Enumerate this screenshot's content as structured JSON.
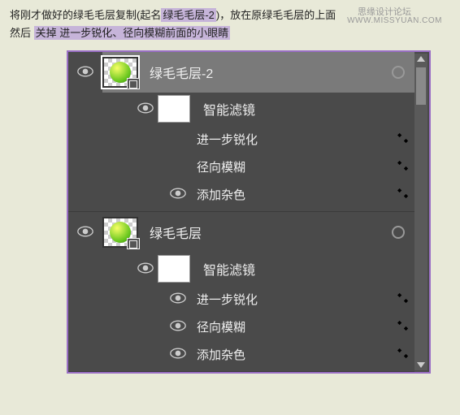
{
  "instructions": {
    "line1_a": "将刚才做好的绿毛毛层复制(起名",
    "line1_hl": "绿毛毛层-2",
    "line1_b": ")，放在原绿毛毛层的上面",
    "line2_a": "然后",
    "line2_hl": "关掉 进一步锐化、径向模糊前面的小眼睛"
  },
  "watermark": {
    "top": "思缘设计论坛",
    "url": "WWW.MISSYUAN.COM"
  },
  "panel": {
    "layers": [
      {
        "name": "绿毛毛层-2",
        "selected": true,
        "smart_filters_label": "智能滤镜",
        "filters": [
          {
            "name": "进一步锐化",
            "visible": false
          },
          {
            "name": "径向模糊",
            "visible": false
          },
          {
            "name": "添加杂色",
            "visible": true
          }
        ]
      },
      {
        "name": "绿毛毛层",
        "selected": false,
        "smart_filters_label": "智能滤镜",
        "filters": [
          {
            "name": "进一步锐化",
            "visible": true
          },
          {
            "name": "径向模糊",
            "visible": true
          },
          {
            "name": "添加杂色",
            "visible": true
          }
        ]
      }
    ]
  }
}
